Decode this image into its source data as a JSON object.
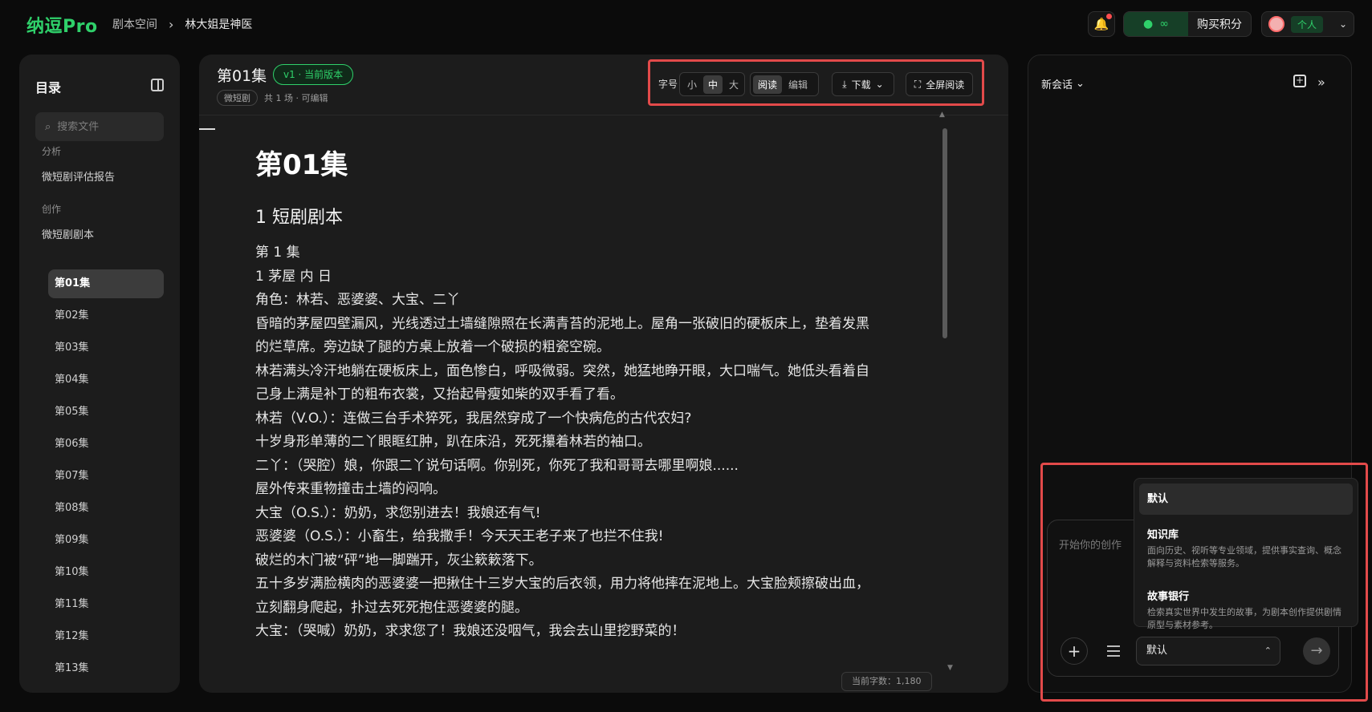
{
  "app": {
    "logo": "纳逗Pro"
  },
  "breadcrumb": {
    "items": [
      "剧本空间",
      "林大姐是神医"
    ],
    "separator": "›"
  },
  "header": {
    "credits_icon": "bean-icon",
    "credits_value": "∞",
    "buy_credits": "购买积分",
    "account_tag": "个人"
  },
  "sidebar": {
    "title": "目录",
    "search_placeholder": "搜索文件",
    "section_analysis": "分析",
    "analysis_item": "微短剧评估报告",
    "section_create": "创作",
    "create_item": "微短剧剧本",
    "episodes": [
      "第01集",
      "第02集",
      "第03集",
      "第04集",
      "第05集",
      "第06集",
      "第07集",
      "第08集",
      "第09集",
      "第10集",
      "第11集",
      "第12集",
      "第13集"
    ],
    "active_index": 0
  },
  "document": {
    "title": "第01集",
    "version_badge": "v1 · 当前版本",
    "tag": "微短剧",
    "meta": "共 1 场 · 可编辑",
    "toolbar": {
      "font_label": "字号",
      "font_sizes": [
        "小",
        "中",
        "大"
      ],
      "font_active": "中",
      "modes": [
        "阅读",
        "编辑"
      ],
      "mode_active": "阅读",
      "download": "下载",
      "fullscreen": "全屏阅读"
    },
    "heading": "第01集",
    "section": "1 短剧剧本",
    "lines": [
      "第 1 集",
      "1 茅屋 内 日",
      "角色：林若、恶婆婆、大宝、二丫",
      "昏暗的茅屋四壁漏风，光线透过土墙缝隙照在长满青苔的泥地上。屋角一张破旧的硬板床上，垫着发黑的烂草席。旁边缺了腿的方桌上放着一个破损的粗瓷空碗。",
      "林若满头冷汗地躺在硬板床上，面色惨白，呼吸微弱。突然，她猛地睁开眼，大口喘气。她低头看着自己身上满是补丁的粗布衣裳，又抬起骨瘦如柴的双手看了看。",
      "林若（V.O.）：连做三台手术猝死，我居然穿成了一个快病危的古代农妇?",
      "十岁身形单薄的二丫眼眶红肿，趴在床沿，死死攥着林若的袖口。",
      "二丫：（哭腔）娘，你跟二丫说句话啊。你别死，你死了我和哥哥去哪里啊娘......",
      "屋外传来重物撞击土墙的闷响。",
      "大宝（O.S.）：奶奶，求您别进去！我娘还有气!",
      "恶婆婆（O.S.）：小畜生，给我撒手！今天天王老子来了也拦不住我!",
      "破烂的木门被“砰”地一脚踹开，灰尘簌簌落下。",
      "五十多岁满脸横肉的恶婆婆一把揪住十三岁大宝的后衣领，用力将他摔在泥地上。大宝脸颊擦破出血，立刻翻身爬起，扑过去死死抱住恶婆婆的腿。",
      "大宝：（哭喊）奶奶，求求您了！我娘还没咽气，我会去山里挖野菜的！"
    ],
    "word_count": "当前字数：1,180"
  },
  "chat": {
    "session_label": "新会话",
    "input_placeholder": "开始你的创作",
    "mode_selected": "默认",
    "options": [
      {
        "title": "默认",
        "desc": ""
      },
      {
        "title": "知识库",
        "desc": "面向历史、视听等专业领域，提供事实查询、概念解释与资料检索等服务。"
      },
      {
        "title": "故事银行",
        "desc": "检索真实世界中发生的故事，为剧本创作提供剧情原型与素材参考。"
      }
    ]
  },
  "colors": {
    "accent": "#2fd06a",
    "highlight_outline": "#e24a4a",
    "background": "#0b0b0b",
    "panel": "#1c1c1c"
  }
}
